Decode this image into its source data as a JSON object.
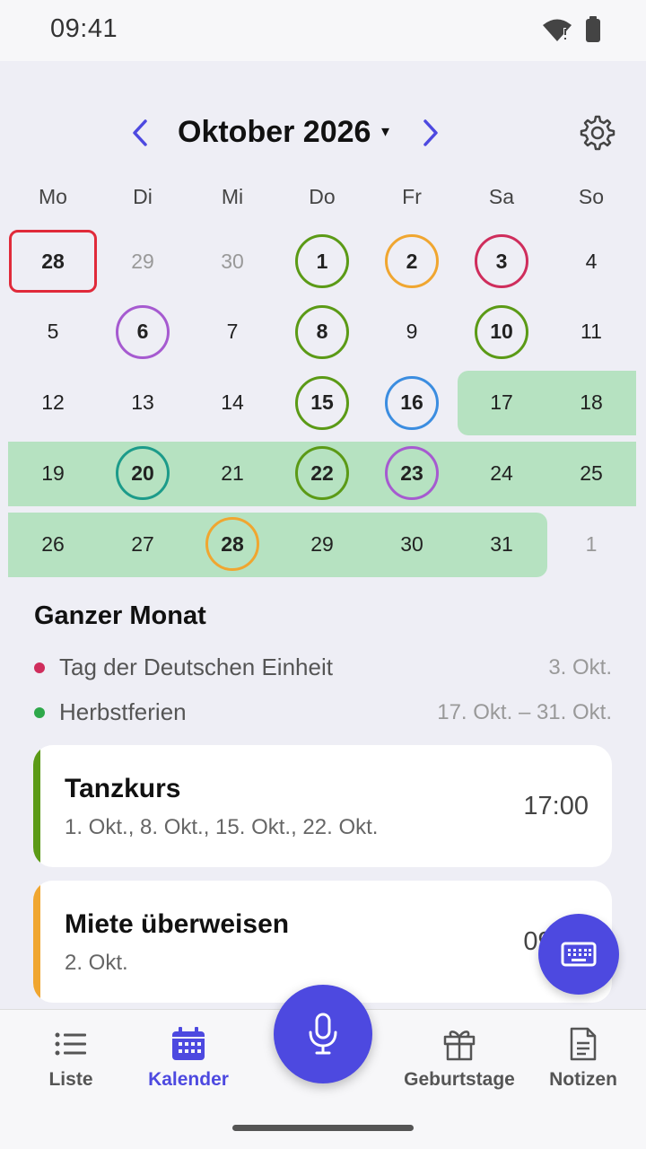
{
  "status": {
    "time": "09:41"
  },
  "header": {
    "title": "Oktober 2026",
    "caret": "▾"
  },
  "weekdays": [
    "Mo",
    "Di",
    "Mi",
    "Do",
    "Fr",
    "Sa",
    "So"
  ],
  "calendar": {
    "rows": [
      [
        {
          "d": "28",
          "style": "today"
        },
        {
          "d": "29",
          "style": "muted"
        },
        {
          "d": "30",
          "style": "muted"
        },
        {
          "d": "1",
          "ring": "#5b9a16"
        },
        {
          "d": "2",
          "ring": "#f0a630"
        },
        {
          "d": "3",
          "ring": "#cf2d5c"
        },
        {
          "d": "4"
        }
      ],
      [
        {
          "d": "5"
        },
        {
          "d": "6",
          "ring": "#a65ad0"
        },
        {
          "d": "7"
        },
        {
          "d": "8",
          "ring": "#5b9a16"
        },
        {
          "d": "9"
        },
        {
          "d": "10",
          "ring": "#5b9a16"
        },
        {
          "d": "11"
        }
      ],
      [
        {
          "d": "12"
        },
        {
          "d": "13"
        },
        {
          "d": "14"
        },
        {
          "d": "15",
          "ring": "#5b9a16"
        },
        {
          "d": "16",
          "ring": "#3b8de0"
        },
        {
          "d": "17"
        },
        {
          "d": "18"
        }
      ],
      [
        {
          "d": "19"
        },
        {
          "d": "20",
          "ring": "#1c9b8a"
        },
        {
          "d": "21"
        },
        {
          "d": "22",
          "ring": "#5b9a16"
        },
        {
          "d": "23",
          "ring": "#a65ad0"
        },
        {
          "d": "24"
        },
        {
          "d": "25"
        }
      ],
      [
        {
          "d": "26"
        },
        {
          "d": "27"
        },
        {
          "d": "28",
          "ring": "#f0a630"
        },
        {
          "d": "29"
        },
        {
          "d": "30"
        },
        {
          "d": "31"
        },
        {
          "d": "1",
          "style": "muted"
        }
      ]
    ],
    "range_color": "#b6e2c1"
  },
  "month_events": {
    "title": "Ganzer Monat",
    "items": [
      {
        "name": "Tag der Deutschen Einheit",
        "date": "3. Okt.",
        "color": "#cf2d5c"
      },
      {
        "name": "Herbstferien",
        "date": "17. Okt. – 31. Okt.",
        "color": "#2ea84a"
      }
    ]
  },
  "cards": [
    {
      "title": "Tanzkurs",
      "sub": "1. Okt., 8. Okt., 15. Okt., 22. Okt.",
      "time": "17:00",
      "color": "#5b9a16"
    },
    {
      "title": "Miete überweisen",
      "sub": "2. Okt.",
      "time": "09:00",
      "color": "#f0a630"
    }
  ],
  "bottom_nav": [
    {
      "label": "Liste",
      "icon": "list-icon"
    },
    {
      "label": "Kalender",
      "icon": "calendar-icon",
      "active": true
    },
    {
      "label": "Geburtstage",
      "icon": "gift-icon"
    },
    {
      "label": "Notizen",
      "icon": "notes-icon"
    }
  ],
  "accent": "#4d49e0"
}
